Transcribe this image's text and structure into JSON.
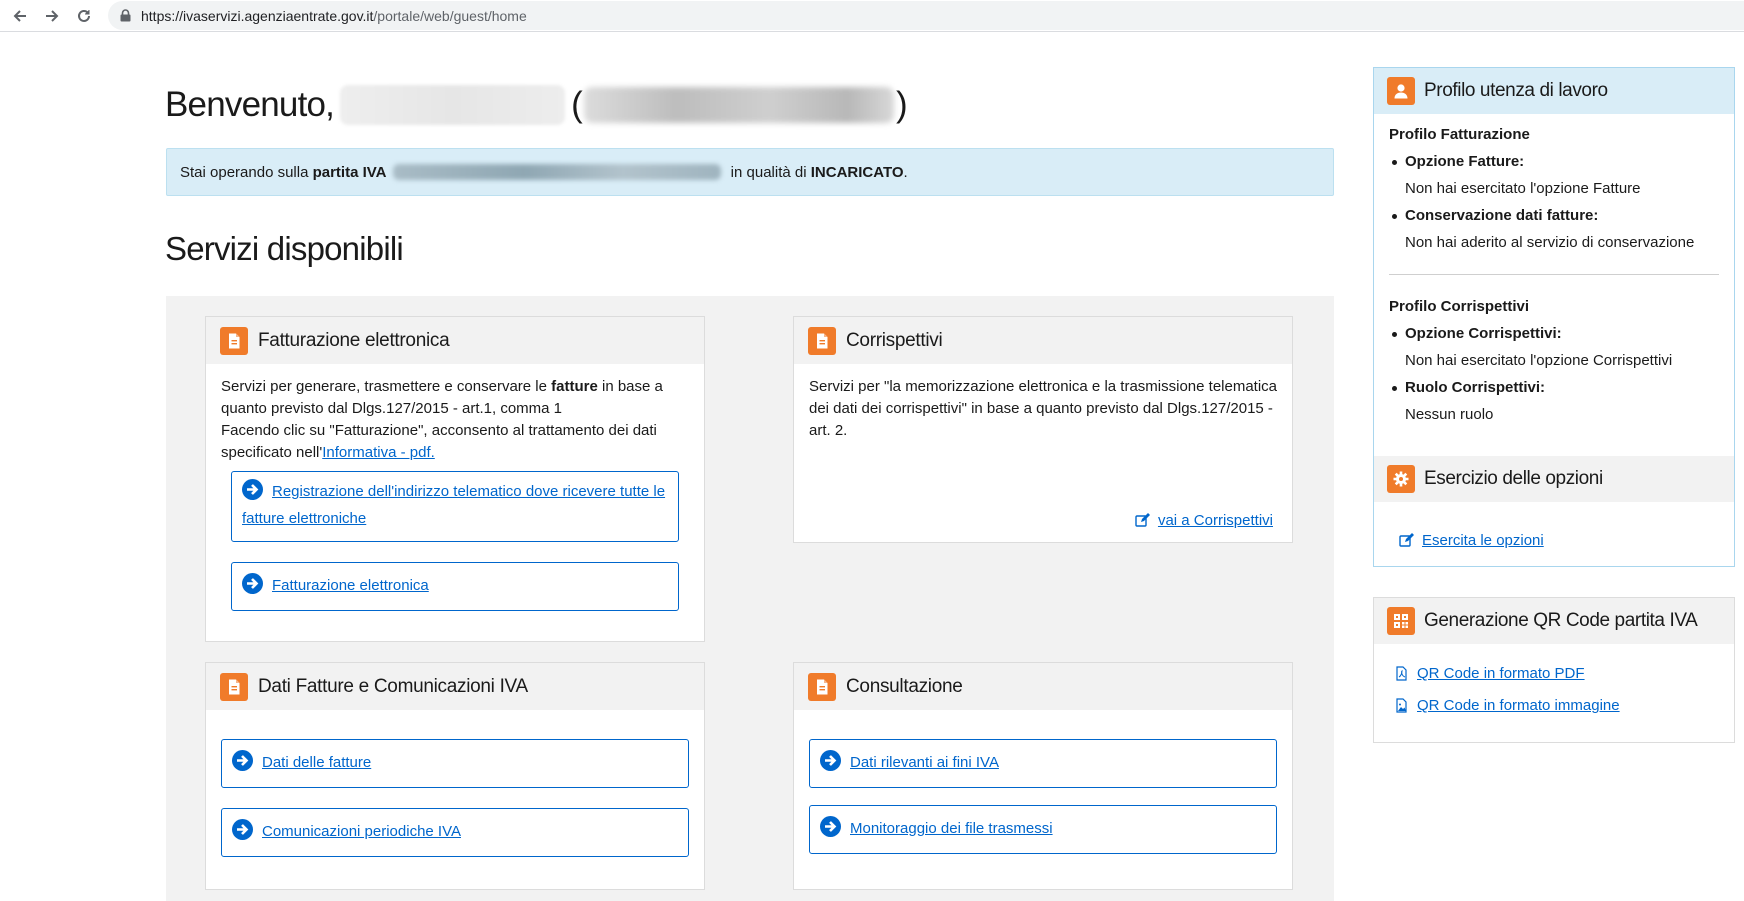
{
  "browser": {
    "url_host": "https://ivaservizi.agenziaentrate.gov.it",
    "url_path": "/portale/web/guest/home"
  },
  "header": {
    "welcome": "Benvenuto,",
    "paren_open": "(",
    "paren_close": ")"
  },
  "info_bar": {
    "prefix": "Stai operando sulla ",
    "strong_label": "partita IVA",
    "middle": " in qualità di ",
    "role": "INCARICATO",
    "suffix": "."
  },
  "services": {
    "title": "Servizi disponibili",
    "fatturazione": {
      "title": "Fatturazione elettronica",
      "desc_1": "Servizi per generare, trasmettere e conservare le ",
      "desc_bold": "fatture",
      "desc_2": " in base a quanto previsto dal Dlgs.127/2015 - art.1, comma 1",
      "desc_3": "Facendo clic su \"Fatturazione\", acconsento al trattamento dei dati specificato nell'",
      "desc_link": "Informativa - pdf.",
      "btn_registrazione": "Registrazione dell'indirizzo telematico dove ricevere tutte le fatture elettroniche",
      "btn_fatturazione": "Fatturazione elettronica"
    },
    "corrispettivi": {
      "title": "Corrispettivi",
      "desc": "Servizi per \"la memorizzazione elettronica e la trasmissione telematica dei dati dei corrispettivi\" in base a quanto previsto dal Dlgs.127/2015 - art. 2.",
      "link": "vai a Corrispettivi"
    },
    "dati_fatture": {
      "title": "Dati Fatture e Comunicazioni IVA",
      "btn_dati": "Dati delle fatture",
      "btn_comunicazioni": "Comunicazioni periodiche IVA"
    },
    "consultazione": {
      "title": "Consultazione",
      "btn_dati_rilevanti": "Dati rilevanti ai fini IVA",
      "btn_monitoraggio": "Monitoraggio dei file trasmessi"
    }
  },
  "profile_panel": {
    "title": "Profilo utenza di lavoro",
    "fatturazione_title": "Profilo Fatturazione",
    "opzione_fatture_label": "Opzione Fatture:",
    "opzione_fatture_value": "Non hai esercitato l'opzione Fatture",
    "conservazione_label": "Conservazione dati fatture:",
    "conservazione_value": "Non hai aderito al servizio di conservazione",
    "corrispettivi_title": "Profilo Corrispettivi",
    "opzione_corr_label": "Opzione Corrispettivi:",
    "opzione_corr_value": "Non hai esercitato l'opzione Corrispettivi",
    "ruolo_label": "Ruolo Corrispettivi:",
    "ruolo_value": "Nessun ruolo",
    "esercizio_title": "Esercizio delle opzioni",
    "esercita_link": "Esercita le opzioni"
  },
  "qr_panel": {
    "title": "Generazione QR Code partita IVA",
    "link_pdf": "QR Code in formato PDF",
    "link_img": "QR Code in formato immagine"
  },
  "colors": {
    "accent_orange": "#f07b2a",
    "link_blue": "#0066cc",
    "info_bg": "#d9edf7"
  }
}
